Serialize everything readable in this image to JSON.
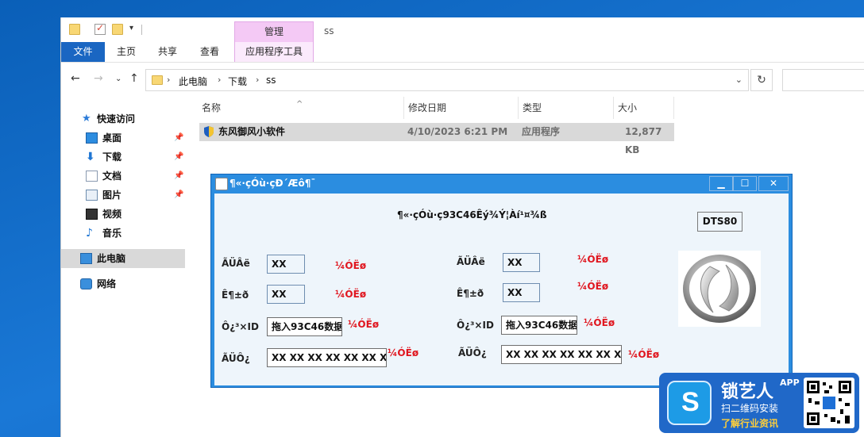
{
  "explorer": {
    "title": "ss",
    "ribbon": {
      "manage_tab": "管理",
      "tabs": [
        "文件",
        "主页",
        "共享",
        "查看"
      ],
      "app_tools": "应用程序工具"
    },
    "breadcrumbs": [
      "此电脑",
      "下载",
      "ss"
    ],
    "sidebar": {
      "quick_access": "快速访问",
      "items": [
        "桌面",
        "下载",
        "文档",
        "图片",
        "视频",
        "音乐"
      ],
      "this_pc": "此电脑",
      "network": "网络"
    },
    "columns": [
      "名称",
      "修改日期",
      "类型",
      "大小"
    ],
    "files": [
      {
        "name": "东风御风小软件",
        "modified": "4/10/2023 6:21 PM",
        "type": "应用程序",
        "size": "12,877 KB"
      }
    ]
  },
  "app": {
    "title": "¶«·çÓù·çÐ´Æô¶¯",
    "header": "¶«·çÓù·ç93C46Êý¾Ý¦Àí¹¤¾ß",
    "dts_button": "DTS80",
    "left": {
      "row1_label": "ÃÜÂë",
      "row1_value": "XX",
      "row1_status": "¼ÓËø",
      "row2_label": "Ê¶±ð",
      "row2_value": "XX",
      "row2_status": "¼ÓËø",
      "row3_label": "Ô¿³×ID",
      "row3_value": "拖入93C46数据",
      "row3_status": "¼ÓËø",
      "row4_label": "ÃÜÔ¿",
      "row4_value": "XX XX XX XX XX XX XX",
      "row4_status": "¼ÓËø"
    },
    "right": {
      "row1_label": "ÃÜÂë",
      "row1_value": "XX",
      "row1_status": "¼ÓËø",
      "row2_label": "Ê¶±ð",
      "row2_value": "XX",
      "row2_status": "¼ÓËø",
      "row3_label": "Ô¿³×ID",
      "row3_value": "拖入93C46数据",
      "row3_status": "¼ÓËø",
      "row4_label": "ÃÜÔ¿",
      "row4_value": "XX XX XX XX XX XX XX",
      "row4_status": "¼ÓËø"
    }
  },
  "watermark": {
    "brand": "锁艺人",
    "badge": "APP",
    "line1": "扫二维码安装",
    "line2": "了解行业资讯"
  },
  "colors": {
    "desktop": "#1a78d6",
    "accent": "#1a66c2",
    "manage_tab": "#f4c9f5",
    "status_red": "#e0161f",
    "dialog_frame": "#2b8de0",
    "dialog_client": "#eef5fb"
  },
  "icons": [
    "folder-icon",
    "checklist-icon",
    "back-arrow-icon",
    "forward-arrow-icon",
    "up-arrow-icon",
    "refresh-icon",
    "star-icon",
    "pin-icon",
    "shield-icon",
    "car-logo-icon",
    "minimize-icon",
    "maximize-icon",
    "close-icon",
    "qr-code-icon"
  ]
}
